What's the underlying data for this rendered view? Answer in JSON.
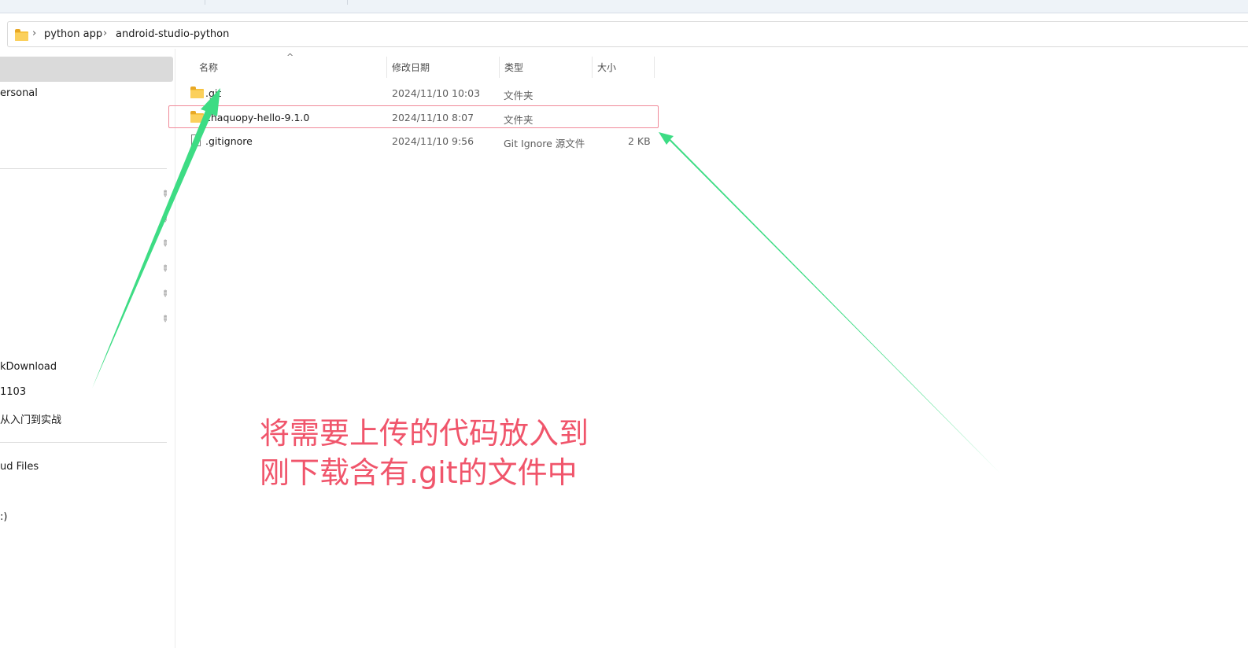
{
  "breadcrumb": {
    "items": [
      "python app",
      "android-studio-python"
    ],
    "separator": "›"
  },
  "sidebar": {
    "items": [
      {
        "label": "ersonal"
      },
      {
        "label": "kDownload"
      },
      {
        "label": "1103"
      },
      {
        "label": "从入门到实战"
      },
      {
        "label": "ud Files"
      },
      {
        "label": ":)"
      }
    ],
    "pin_glyph": "📌"
  },
  "columns": {
    "name": "名称",
    "date": "修改日期",
    "type": "类型",
    "size": "大小"
  },
  "files": [
    {
      "name": ".git",
      "date": "2024/11/10 10:03",
      "type": "文件夹",
      "size": "",
      "icon": "folder-icon"
    },
    {
      "name": "chaquopy-hello-9.1.0",
      "date": "2024/11/10 8:07",
      "type": "文件夹",
      "size": "",
      "icon": "folder-icon"
    },
    {
      "name": ".gitignore",
      "date": "2024/11/10 9:56",
      "type": "Git Ignore 源文件",
      "size": "2 KB",
      "icon": "file-icon"
    }
  ],
  "annotation": {
    "line1": "将需要上传的代码放入到",
    "line2": "刚下载含有.git的文件中",
    "color": "#f0556b"
  },
  "colors": {
    "arrow": "#3ddc84",
    "highlight": "#f08a99",
    "selected": "#dadada"
  }
}
